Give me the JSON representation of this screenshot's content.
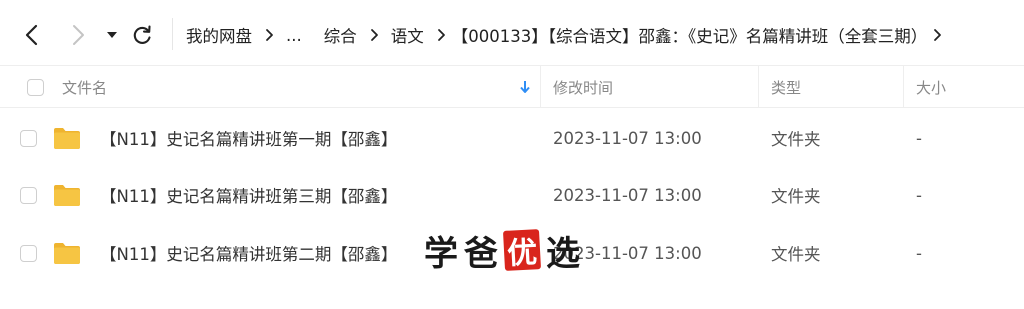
{
  "toolbar": {
    "breadcrumb": [
      "我的网盘",
      "...",
      "综合",
      "语文",
      "【000133】【综合语文】邵鑫：《史记》名篇精讲班（全套三期）"
    ]
  },
  "header": {
    "name": "文件名",
    "modified": "修改时间",
    "type": "类型",
    "size": "大小"
  },
  "files": [
    {
      "name": "【N11】史记名篇精讲班第一期【邵鑫】",
      "modified": "2023-11-07 13:00",
      "type": "文件夹",
      "size": "-"
    },
    {
      "name": "【N11】史记名篇精讲班第三期【邵鑫】",
      "modified": "2023-11-07 13:00",
      "type": "文件夹",
      "size": "-"
    },
    {
      "name": "【N11】史记名篇精讲班第二期【邵鑫】",
      "modified": "2023-11-07 13:00",
      "type": "文件夹",
      "size": "-"
    }
  ],
  "watermark": {
    "chars": [
      "学",
      "爸",
      "优",
      "选"
    ]
  },
  "colors": {
    "sort_arrow": "#2f8ef5",
    "folder": "#f6c543",
    "folder_dark": "#efb42f",
    "seal": "#d9251c"
  },
  "icons": {
    "back": "chevron-left-icon",
    "forward": "chevron-right-icon",
    "history": "caret-down-icon",
    "refresh": "refresh-icon",
    "sort": "arrow-down-icon",
    "folder": "folder-icon"
  }
}
